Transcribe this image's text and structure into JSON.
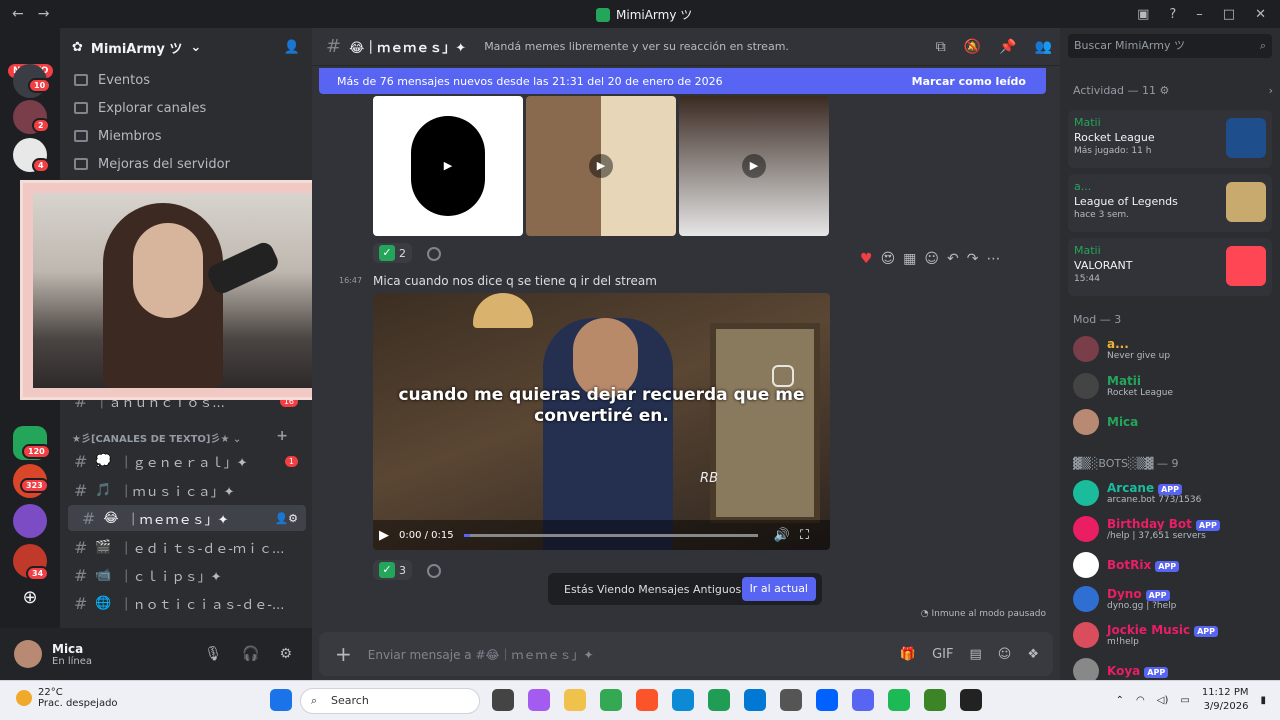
{
  "window": {
    "title": "MimiArmy ツ"
  },
  "guilds": {
    "nuevo_label": "NUEVO",
    "badges": [
      "10",
      "2",
      "4",
      "120",
      "323",
      "34"
    ]
  },
  "server": {
    "name": "MimiArmy ツ",
    "nav": [
      "Eventos",
      "Explorar canales",
      "Miembros",
      "Mejoras del servidor"
    ],
    "category": "★彡[CANALES DE TEXTO]彡★",
    "channels": [
      {
        "icon": "💭",
        "name": "｜ｇｅｎｅｒａｌ」✦",
        "badge": "1"
      },
      {
        "icon": "🎵",
        "name": "｜ｍｕｓｉｃａ」✦",
        "badge": ""
      },
      {
        "icon": "😂",
        "name": "｜ｍｅｍｅｓ」✦",
        "badge": ""
      },
      {
        "icon": "🎬",
        "name": "｜ｅｄｉｔｓ-ｄｅ-ｍｉｃ...",
        "badge": ""
      },
      {
        "icon": "📹",
        "name": "｜ｃｌｉｐｓ」✦",
        "badge": ""
      },
      {
        "icon": "🌐",
        "name": "｜ｎｏｔｉｃｉａｓ-ｄｅ-...",
        "badge": ""
      }
    ],
    "hidden_channel": {
      "name": "｜ａｎｕｎｃｉｏｓ...",
      "badge": "16"
    }
  },
  "user": {
    "name": "Mica",
    "status": "En línea"
  },
  "channel": {
    "name": "😂｜ｍｅｍｅｓ」✦",
    "topic": "Mandá memes libremente y ver su reacción en stream."
  },
  "newbar": {
    "text": "Más de 76 mensajes nuevos desde las 21:31 del 20 de enero de 2026",
    "mark_read": "Marcar como leído"
  },
  "messages": {
    "reaction1_count": "2",
    "time": "16:47",
    "text": "Mica cuando nos dice q se tiene q ir del stream",
    "video_caption": "cuando me quieras dejar recuerda que me convertiré en.",
    "video_watermark": "RB",
    "video_time": "0:00 / 0:15",
    "reaction2_count": "3"
  },
  "toast": {
    "text": "Estás Viendo Mensajes Antiguos",
    "button": "Ir al actual"
  },
  "immune": "Inmune al modo pausado",
  "composer": {
    "placeholder": "Enviar mensaje a #😂｜ｍｅｍｅｓ」✦"
  },
  "members": {
    "search_placeholder": "Buscar MimiArmy ツ",
    "activity_header": "Actividad — 11",
    "activities": [
      {
        "who": "Matii",
        "game": "Rocket League",
        "sub": "Más jugado: 11 h",
        "color": "#1f4e8c"
      },
      {
        "who": "a...",
        "game": "League of Legends",
        "sub": "hace 3 sem.",
        "color": "#c8aa6e"
      },
      {
        "who": "Matii",
        "game": "VALORANT",
        "sub": "15:44",
        "color": "#ff4655"
      }
    ],
    "mod_header": "Mod — 3",
    "mods": [
      {
        "name": "a...",
        "status": "Never give up",
        "color": "#f0b232"
      },
      {
        "name": "Matii",
        "status": "Rocket League",
        "color": "#23a55a"
      },
      {
        "name": "Mica",
        "status": "",
        "color": "#23a55a"
      }
    ],
    "bots_header": "▓▒░BOTS░▒▓ — 9",
    "bots": [
      {
        "name": "Arcane",
        "status": "arcane.bot 773/1536",
        "color": "#1abc9c"
      },
      {
        "name": "Birthday Bot",
        "status": "/help | 37,651 servers",
        "color": "#e91e63"
      },
      {
        "name": "BotRix",
        "status": "",
        "color": "#e91e63"
      },
      {
        "name": "Dyno",
        "status": "dyno.gg | ?help",
        "color": "#e91e63"
      },
      {
        "name": "Jockie Music",
        "status": "m!help",
        "color": "#e91e63"
      },
      {
        "name": "Koya",
        "status": "",
        "color": "#e91e63"
      }
    ],
    "app_label": "APP"
  },
  "taskbar": {
    "temp": "22°C",
    "weather": "Prac. despejado",
    "search": "Search",
    "time": "11:12 PM",
    "date": "3/9/2026"
  }
}
